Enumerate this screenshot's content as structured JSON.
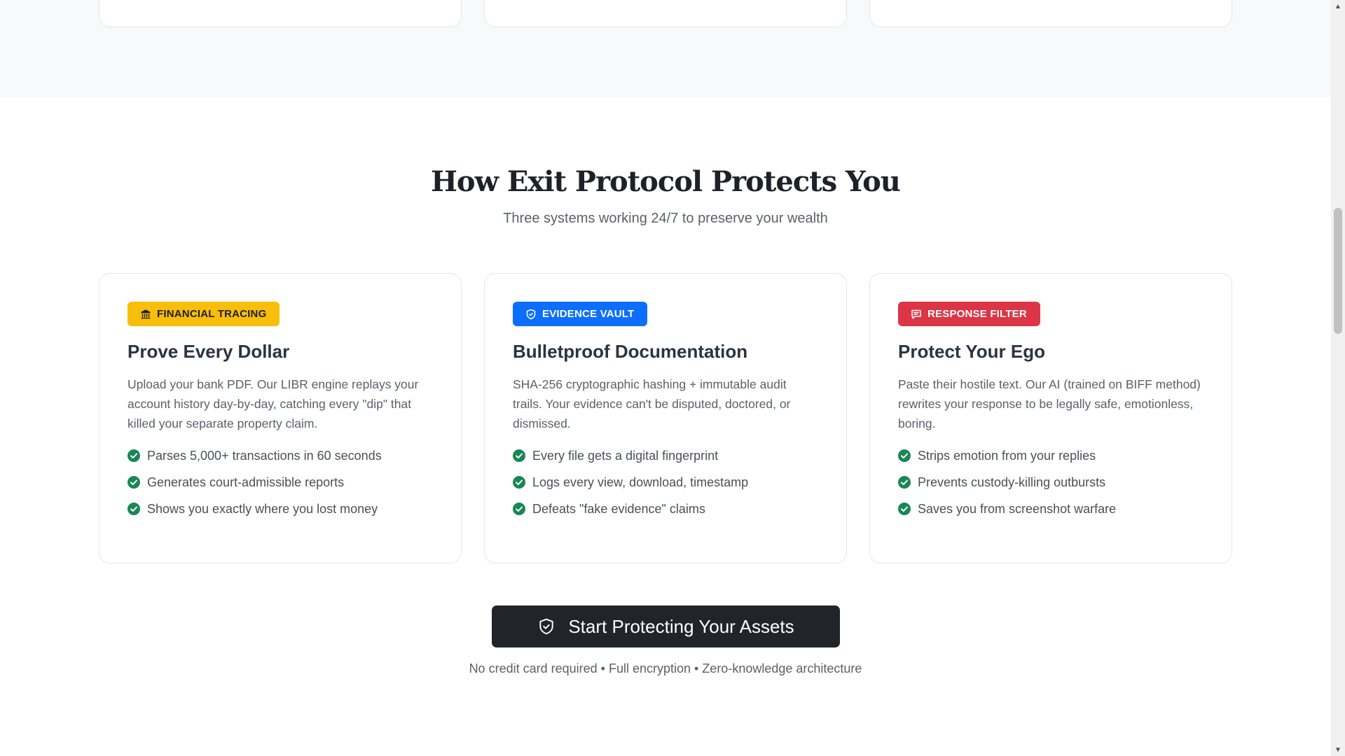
{
  "section": {
    "title": "How Exit Protocol Protects You",
    "subtitle": "Three systems working 24/7 to preserve your wealth"
  },
  "cards": [
    {
      "badge": "FINANCIAL TRACING",
      "badge_icon": "bank-icon",
      "badge_color": "#f9bd0b",
      "badge_text_color": "#1d2128",
      "title": "Prove Every Dollar",
      "description": "Upload your bank PDF. Our LIBR engine replays your account history day-by-day, catching every \"dip\" that killed your separate property claim.",
      "features": [
        "Parses 5,000+ transactions in 60 seconds",
        "Generates court-admissible reports",
        "Shows you exactly where you lost money"
      ]
    },
    {
      "badge": "EVIDENCE VAULT",
      "badge_icon": "shield-icon",
      "badge_color": "#0d6efd",
      "badge_text_color": "#ffffff",
      "title": "Bulletproof Documentation",
      "description": "SHA-256 cryptographic hashing + immutable audit trails. Your evidence can't be disputed, doctored, or dismissed.",
      "features": [
        "Every file gets a digital fingerprint",
        "Logs every view, download, timestamp",
        "Defeats \"fake evidence\" claims"
      ]
    },
    {
      "badge": "RESPONSE FILTER",
      "badge_icon": "chat-icon",
      "badge_color": "#dc3545",
      "badge_text_color": "#ffffff",
      "title": "Protect Your Ego",
      "description": "Paste their hostile text. Our AI (trained on BIFF method) rewrites your response to be legally safe, emotionless, boring.",
      "features": [
        "Strips emotion from your replies",
        "Prevents custody-killing outbursts",
        "Saves you from screenshot warfare"
      ]
    }
  ],
  "check_color": "#198754",
  "cta": {
    "label": "Start Protecting Your Assets",
    "icon": "shield-check-icon",
    "note": "No credit card required • Full encryption • Zero-knowledge architecture"
  }
}
